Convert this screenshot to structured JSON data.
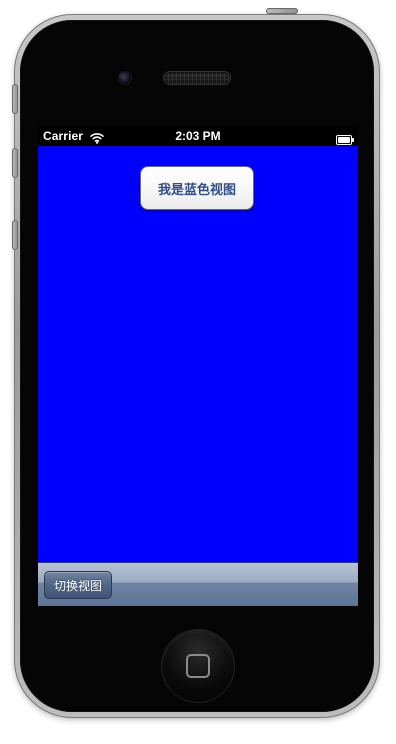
{
  "status_bar": {
    "carrier": "Carrier",
    "time": "2:03 PM",
    "wifi_icon": "wifi-icon",
    "battery_icon": "battery-icon"
  },
  "screen": {
    "background_color": "#0000ff",
    "title_button_label": "我是蓝色视图"
  },
  "toolbar": {
    "switch_button_label": "切换视图"
  },
  "device": {
    "camera_icon": "camera-icon",
    "speaker_icon": "speaker-grille",
    "home_button_icon": "home-button-icon"
  }
}
